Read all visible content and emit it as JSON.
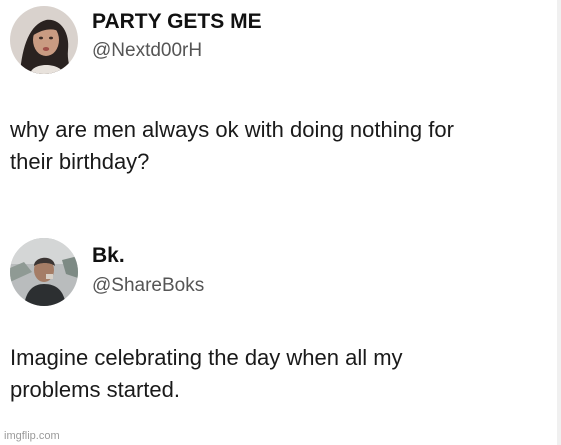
{
  "tweets": [
    {
      "display_name": "PARTY GETS ME",
      "handle": "@Nextd00rH",
      "text_lines": [
        "why are men always ok with doing nothing for",
        "their birthday?"
      ],
      "avatar_icon": "profile-photo-woman"
    },
    {
      "display_name": "Bk.",
      "handle": "@ShareBoks",
      "text_lines": [
        "Imagine celebrating the day when all my",
        "problems started."
      ],
      "avatar_icon": "profile-photo-man"
    }
  ],
  "watermark": "imgflip.com",
  "colors": {
    "background": "#ffffff",
    "text": "#1a1a1a",
    "handle": "#555555",
    "watermark": "#9a9a9a"
  }
}
